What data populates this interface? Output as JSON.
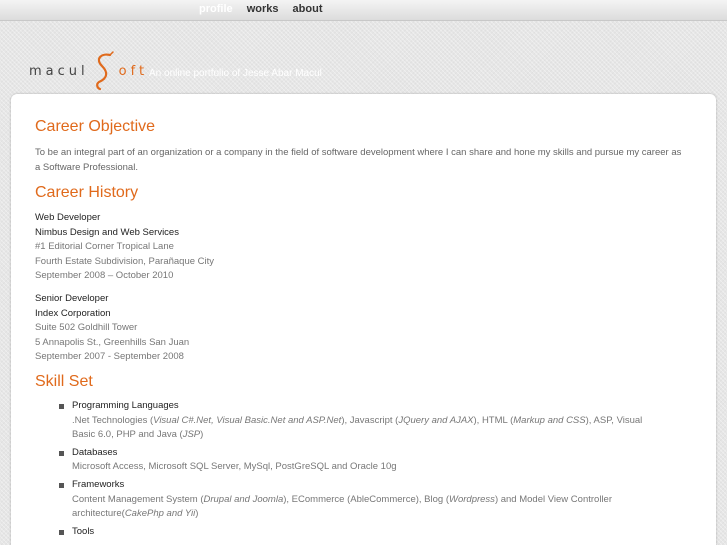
{
  "nav": {
    "items": [
      {
        "label": "profile",
        "active": true
      },
      {
        "label": "works",
        "active": false
      },
      {
        "label": "about",
        "active": false
      }
    ]
  },
  "header": {
    "logo_left": "macul",
    "logo_right": "oft",
    "tagline": "An online portfolio of Jesse Abar Macul"
  },
  "objective": {
    "heading": "Career Objective",
    "text": "To be an integral part of an organization or a company in the field of software development where I can share and hone my skills and pursue my career as a Software Professional."
  },
  "history": {
    "heading": "Career History",
    "jobs": [
      {
        "title": "Web Developer",
        "company": "Nimbus Design and Web Services",
        "address1": "#1 Editorial Corner Tropical Lane",
        "address2": "Fourth Estate Subdivision, Parañaque City",
        "dates": "September 2008 – October 2010"
      },
      {
        "title": "Senior Developer",
        "company": "Index Corporation",
        "address1": "Suite 502 Goldhill Tower",
        "address2": "5 Annapolis St., Greenhills San Juan",
        "dates": "September 2007 - September 2008"
      }
    ]
  },
  "skills": {
    "heading": "Skill Set",
    "items": [
      {
        "name": "Programming Languages",
        "parts": [
          {
            "t": ".Net Technologies (",
            "i": false
          },
          {
            "t": "Visual C#.Net, Visual Basic.Net and ASP.Net",
            "i": true
          },
          {
            "t": "), Javascript (",
            "i": false
          },
          {
            "t": "JQuery and AJAX",
            "i": true
          },
          {
            "t": "), HTML (",
            "i": false
          },
          {
            "t": "Markup and CSS",
            "i": true
          },
          {
            "t": "), ASP, Visual Basic 6.0, PHP and Java (",
            "i": false
          },
          {
            "t": "JSP",
            "i": true
          },
          {
            "t": ")",
            "i": false
          }
        ]
      },
      {
        "name": "Databases",
        "parts": [
          {
            "t": "Microsoft Access, Microsoft SQL Server, MySql, PostGreSQL and Oracle 10g",
            "i": false
          }
        ]
      },
      {
        "name": "Frameworks",
        "parts": [
          {
            "t": "Content Management System (",
            "i": false
          },
          {
            "t": "Drupal and Joomla",
            "i": true
          },
          {
            "t": "), ECommerce (AbleCommerce), Blog (",
            "i": false
          },
          {
            "t": "Wordpress",
            "i": true
          },
          {
            "t": ") and Model View Controller architecture(",
            "i": false
          },
          {
            "t": "CakePhp and Yii",
            "i": true
          },
          {
            "t": ")",
            "i": false
          }
        ]
      },
      {
        "name": "Tools",
        "parts": []
      }
    ]
  },
  "colors": {
    "accent": "#e06a1c",
    "text_dark": "#222222",
    "text_gray": "#777777",
    "nav_active": "#ffffff"
  }
}
